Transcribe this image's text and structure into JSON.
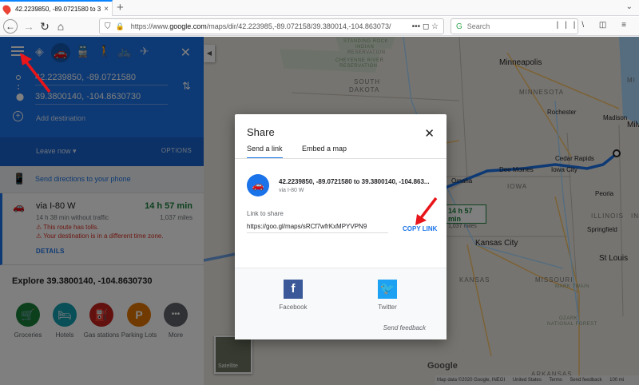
{
  "browser": {
    "tab_title": "42.2239850, -89.0721580 to 39.3800",
    "tab_close": "×",
    "new_tab": "+",
    "url_prefix": "https://www.",
    "url_domain": "google.com",
    "url_rest": "/maps/dir/42.223985,-89.072158/39.380014,-104.863073/",
    "url_actions": "•••  ◻  ☆",
    "search_placeholder": "Search",
    "right_icons": "|||\\ ◫ ≡"
  },
  "panel": {
    "origin": "42.2239850, -89.0721580",
    "destination": "39.3800140, -104.8630730",
    "add_destination": "Add destination",
    "leave_now": "Leave now  ▾",
    "options": "OPTIONS",
    "send_to_phone": "Send directions to your phone",
    "route": {
      "via": "via I-80 W",
      "time": "14 h 57 min",
      "traffic": "14 h 38 min without traffic",
      "distance": "1,037 miles",
      "warning1": "⚠ This route has tolls.",
      "warning2": "⚠ Your destination is in a different time zone.",
      "details": "DETAILS"
    },
    "explore_title": "Explore 39.3800140, -104.8630730",
    "categories": [
      {
        "label": "Groceries",
        "color": "#188038",
        "icon": "cart-icon",
        "glyph": "🛒"
      },
      {
        "label": "Hotels",
        "color": "#129eaf",
        "icon": "bed-icon",
        "glyph": "🛏"
      },
      {
        "label": "Gas stations",
        "color": "#c5221f",
        "icon": "gas-pump-icon",
        "glyph": "⛽"
      },
      {
        "label": "Parking Lots",
        "color": "#e37400",
        "icon": "parking-icon",
        "glyph": "P"
      },
      {
        "label": "More",
        "color": "#5f6368",
        "icon": "more-icon",
        "glyph": "•••"
      }
    ]
  },
  "map": {
    "labels": {
      "standing_rock": "STANDING ROCK",
      "indian_res": "INDIAN",
      "reservation": "RESERVATION",
      "cheyenne": "CHEYENNE RIVER",
      "reservation2": "RESERVATION",
      "south": "SOUTH",
      "dakota": "DAKOTA",
      "minnesota": "MINNESOTA",
      "iowa": "IOWA",
      "illinois": "ILLINOIS",
      "missouri": "MISSOURI",
      "kansas": "KANSAS",
      "indiana": "IN",
      "mi": "MI",
      "minneapolis": "Minneapolis",
      "rochester": "Rochester",
      "madison": "Madison",
      "milwaukee": "Milw",
      "cedar_rapids": "Cedar Rapids",
      "des_moines": "Dee Moines",
      "iowa_city": "Iowa City",
      "peoria": "Peoria",
      "springfield": "Springfield",
      "kansas_city": "Kansas City",
      "st_louis": "St Louis",
      "omaha": "Omaha",
      "ozark": "OZARK",
      "national_forest": "NATIONAL FOREST",
      "mark_twain": "MARK TWAIN",
      "arkansas": "ARKANSAS",
      "satellite": "Satellite",
      "google": "Google",
      "route_time": "14 h 57 min",
      "route_miles": "1,037 miles"
    },
    "footer": [
      "Map data ©2020 Google, INEGI",
      "United States",
      "Terms",
      "Send feedback",
      "100 mi"
    ]
  },
  "dialog": {
    "title": "Share",
    "close": "✕",
    "tab_send": "Send a link",
    "tab_embed": "Embed a map",
    "route_title": "42.2239850, -89.0721580 to 39.3800140, -104.863...",
    "route_sub": "via I-80 W",
    "link_label": "Link to share",
    "link": "https://goo.gl/maps/sRCf7wfrKxMPYVPN9",
    "copy": "COPY LINK",
    "facebook": "Facebook",
    "twitter": "Twitter",
    "feedback": "Send feedback"
  },
  "colors": {
    "panel_blue": "#1a73e8",
    "route_green": "#188038",
    "annotation_red": "#e8151b"
  }
}
